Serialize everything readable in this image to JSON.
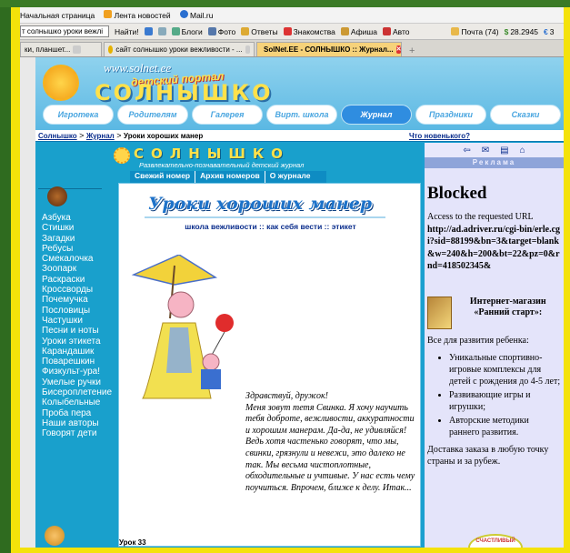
{
  "bookmarks": [
    "Начальная страница",
    "Лента новостей",
    "Mail.ru"
  ],
  "toolbar": {
    "search_value": "т солнышко уроки вежлі",
    "find": "Найти!",
    "items": [
      "Блоги",
      "Фото",
      "Ответы",
      "Знакомства",
      "Афиша",
      "Авто"
    ],
    "mail": "Почта (74)",
    "usd": "28.2945",
    "eur": "3"
  },
  "tabs": [
    "ки, планшет...",
    "сайт солнышко уроки вежливости - ...",
    "SolNet.EE - СОЛНЫШКО :: Журнал..."
  ],
  "site": {
    "url": "www.solnet.ee",
    "portal": "детский портал",
    "logo": "СОЛНЫШКО",
    "clouds": [
      "Игротека",
      "Родителям",
      "Галерея",
      "Вирт. школа",
      "Журнал",
      "Праздники",
      "Сказки"
    ]
  },
  "breadcrumb": {
    "home": "Солнышко",
    "section": "Журнал",
    "current": "Уроки хороших манер",
    "whats_new": "Что новенького?"
  },
  "journal": {
    "title": "СОЛНЫШКО",
    "subtitle": "Развлекательно-познавательный детский журнал",
    "menu": [
      "Свежий номер",
      "Архив номеров",
      "О журнале"
    ],
    "nav": [
      "Азбука",
      "Стишки",
      "Загадки",
      "Ребусы",
      "Смекалочка",
      "Зоопарк",
      "Раскраски",
      "Кроссворды",
      "Почемучка",
      "Пословицы",
      "Частушки",
      "Песни и ноты",
      "Уроки этикета",
      "Карандашик",
      "Поварешкин",
      "Физкульт-ура!",
      "Умелые ручки",
      "Бисероплетение",
      "Колыбельные",
      "Проба пера",
      "Наши авторы",
      "Говорят дети"
    ]
  },
  "article": {
    "title": "Уроки хороших манер",
    "subtitle": "школа вежливости :: как себя вести :: этикет",
    "greeting": "Здравствуй, дружок!",
    "body": "Меня зовут тетя Свинка. Я хочу научить тебя доброте, вежливости, аккуратности и хорошим манерам. Да-да, не удивляйся! Ведь хотя частенько говорят, что мы, свинки, грязнули и невежи, это далеко не так. Мы весьма чистоплотные, обходительные и учтивые. У нас есть чему поучиться. Впрочем, ближе к делу. Итак...",
    "lesson": "Урок 33"
  },
  "ad": {
    "label": "Реклама",
    "blocked_title": "Blocked",
    "blocked_text": "Access to the requested URL",
    "blocked_url": "http://ad.adriver.ru/cgi-bin/erle.cgi?sid=88199&bn=3&target=blank&w=240&h=200&bt=22&pz=0&rnd=418502345&",
    "shop_title": "Интернет-магазин «Ранний старт»:",
    "shop_intro": "Все для развития ребенка:",
    "bullets": [
      "Уникальные спортивно-игровые комплексы для детей с рождения до 4-5 лет;",
      "Развивающие игры и игрушки;",
      "Авторские методики раннего развития."
    ],
    "delivery": "Доставка заказа в любую точку страны и за рубеж.",
    "badge": "СЧАСТЛИВЫЙ"
  }
}
